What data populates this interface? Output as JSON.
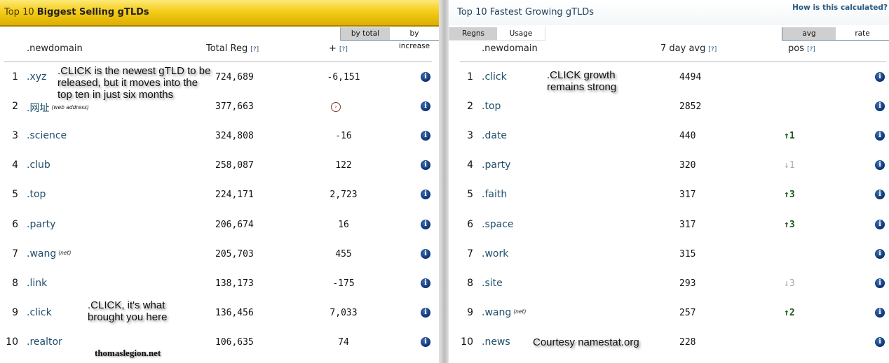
{
  "left": {
    "title_prefix": "Top 10",
    "title_main": "Biggest Selling gTLDs",
    "tabs": [
      {
        "label": "by total",
        "active": true
      },
      {
        "label": "by increase",
        "active": false
      }
    ],
    "columns": {
      "domain": ".newdomain",
      "total": "Total Reg",
      "total_help": "[?]",
      "plus": "+",
      "plus_help": "[?]"
    },
    "rows": [
      {
        "rank": "1",
        "tld": ".xyz",
        "note": "",
        "total": "724,689",
        "change": "-6,151"
      },
      {
        "rank": "2",
        "tld": ".网址",
        "note": "(web address)",
        "total": "377,663",
        "change": "",
        "change_icon": "clock-icon"
      },
      {
        "rank": "3",
        "tld": ".science",
        "note": "",
        "total": "324,808",
        "change": "-16"
      },
      {
        "rank": "4",
        "tld": ".club",
        "note": "",
        "total": "258,087",
        "change": "122"
      },
      {
        "rank": "5",
        "tld": ".top",
        "note": "",
        "total": "224,171",
        "change": "2,723"
      },
      {
        "rank": "6",
        "tld": ".party",
        "note": "",
        "total": "206,674",
        "change": "16"
      },
      {
        "rank": "7",
        "tld": ".wang",
        "note": "(net)",
        "total": "205,703",
        "change": "455"
      },
      {
        "rank": "8",
        "tld": ".link",
        "note": "",
        "total": "138,173",
        "change": "-175"
      },
      {
        "rank": "9",
        "tld": ".click",
        "note": "",
        "total": "136,456",
        "change": "7,033"
      },
      {
        "rank": "10",
        "tld": ".realtor",
        "note": "",
        "total": "106,635",
        "change": "74"
      }
    ]
  },
  "right": {
    "title": "Top 10 Fastest Growing gTLDs",
    "how_link": "How is this calculated?",
    "type_tabs": [
      {
        "label": "Regns",
        "active": true
      },
      {
        "label": "Usage",
        "active": false
      }
    ],
    "mode_tabs": [
      {
        "label": "avg",
        "active": true
      },
      {
        "label": "rate",
        "active": false
      }
    ],
    "columns": {
      "domain": ".newdomain",
      "avg": "7 day avg",
      "avg_help": "[?]",
      "pos": "pos",
      "pos_help": "[?]"
    },
    "rows": [
      {
        "rank": "1",
        "tld": ".click",
        "note": "",
        "avg": "4494",
        "pos": "",
        "dir": ""
      },
      {
        "rank": "2",
        "tld": ".top",
        "note": "",
        "avg": "2852",
        "pos": "",
        "dir": ""
      },
      {
        "rank": "3",
        "tld": ".date",
        "note": "",
        "avg": "440",
        "pos": "1",
        "dir": "up"
      },
      {
        "rank": "4",
        "tld": ".party",
        "note": "",
        "avg": "320",
        "pos": "1",
        "dir": "down"
      },
      {
        "rank": "5",
        "tld": ".faith",
        "note": "",
        "avg": "317",
        "pos": "3",
        "dir": "up"
      },
      {
        "rank": "6",
        "tld": ".space",
        "note": "",
        "avg": "317",
        "pos": "3",
        "dir": "up"
      },
      {
        "rank": "7",
        "tld": ".work",
        "note": "",
        "avg": "315",
        "pos": "",
        "dir": ""
      },
      {
        "rank": "8",
        "tld": ".site",
        "note": "",
        "avg": "293",
        "pos": "3",
        "dir": "down"
      },
      {
        "rank": "9",
        "tld": ".wang",
        "note": "(net)",
        "avg": "257",
        "pos": "2",
        "dir": "up"
      },
      {
        "rank": "10",
        "tld": ".news",
        "note": "",
        "avg": "228",
        "pos": "",
        "dir": ""
      }
    ]
  },
  "annotations": {
    "newest": ".CLICK is the newest gTLD to be released, but it moves into the top ten in just six months",
    "brought": ".CLICK, it's what brought you here",
    "growth": ".CLICK growth remains strong",
    "courtesy": "Courtesy namestat.org",
    "watermark": "thomaslegion.net"
  },
  "icons": {
    "info": "info-icon",
    "up": "↑",
    "down": "↓"
  }
}
